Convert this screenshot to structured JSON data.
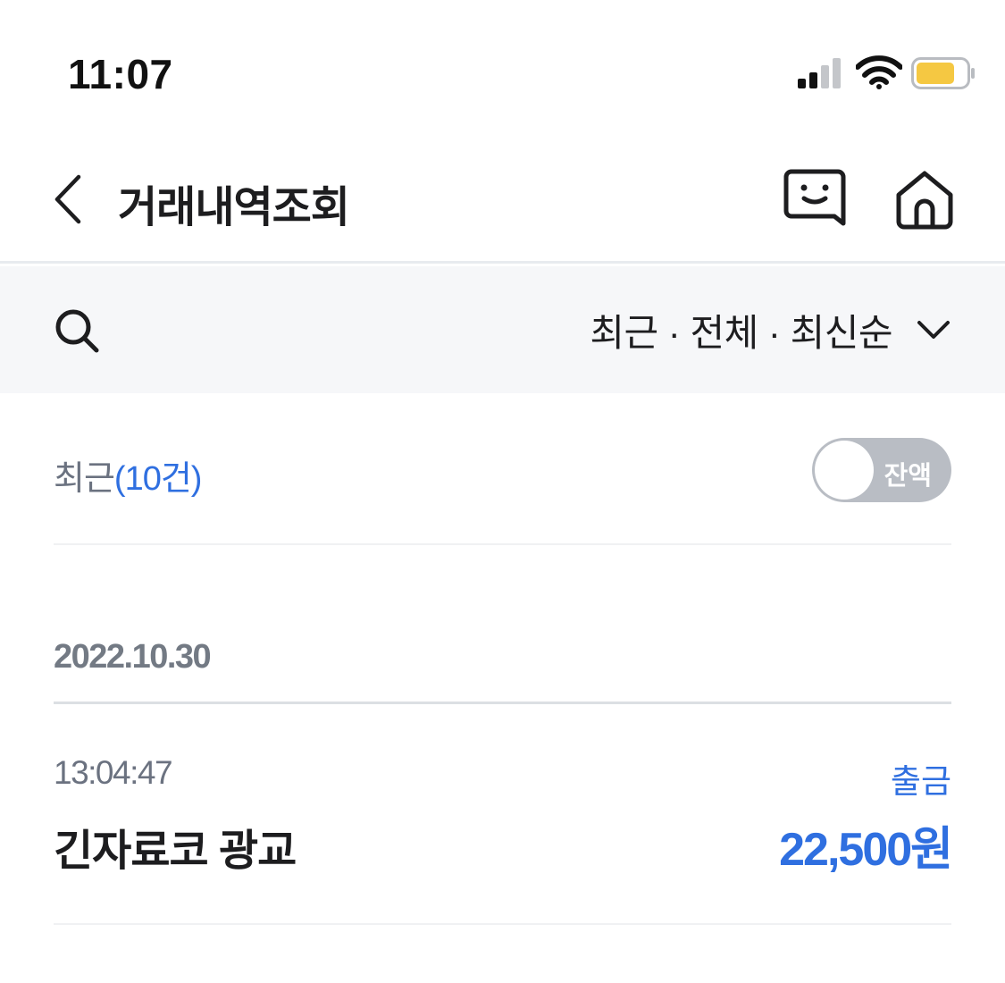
{
  "status_bar": {
    "time": "11:07",
    "battery_color": "#f5c842"
  },
  "header": {
    "title": "거래내역조회",
    "back_icon": "chevron-left-icon",
    "chat_icon": "chatbot-icon",
    "home_icon": "home-icon"
  },
  "filter": {
    "summary": "최근 · 전체 · 최신순",
    "search_icon": "search-icon",
    "dropdown_icon": "chevron-down-icon"
  },
  "list_summary": {
    "label": "최근",
    "count": "(10건)",
    "balance_toggle_label": "잔액",
    "balance_toggle_on": false
  },
  "groups": [
    {
      "date": "2022.10.30",
      "transactions": [
        {
          "time": "13:04:47",
          "type": "출금",
          "name": "긴자료코 광교",
          "amount": "22,500원"
        }
      ]
    }
  ],
  "colors": {
    "accent": "#2f6fe0",
    "filter_bg": "#f6f7f9",
    "toggle_off": "#b9bdc4"
  }
}
